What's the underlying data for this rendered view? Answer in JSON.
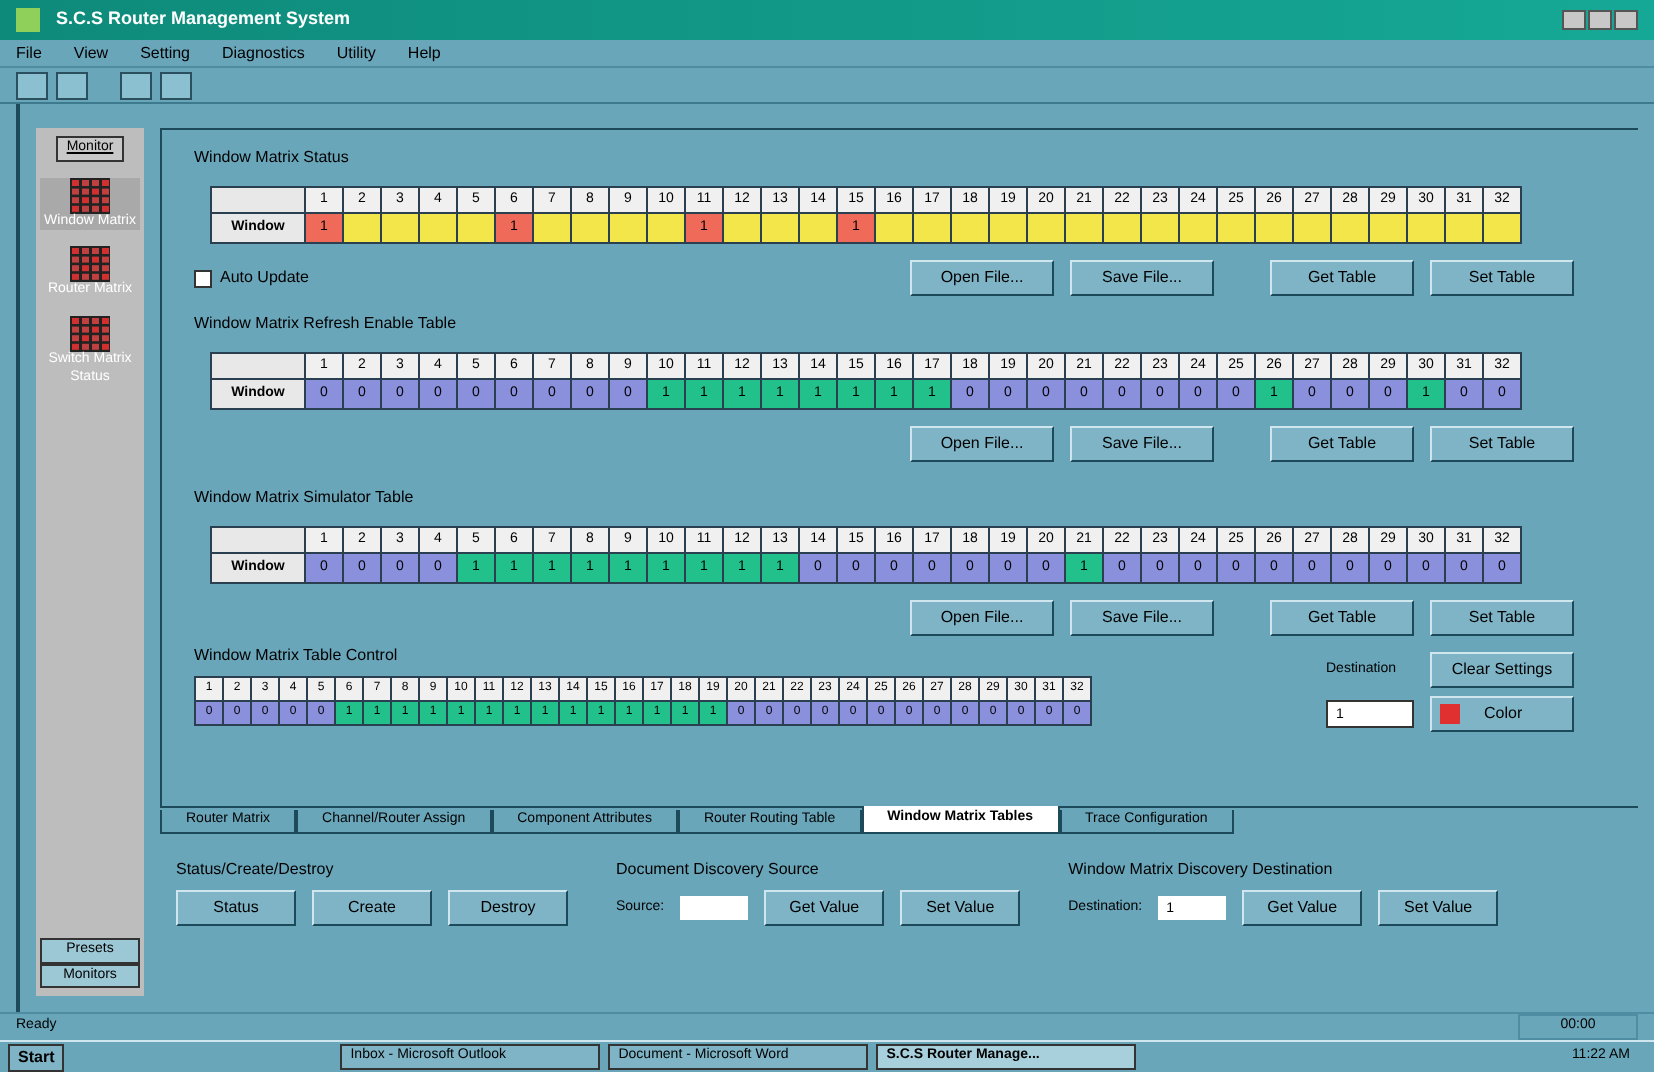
{
  "window": {
    "title": "S.C.S Router Management System"
  },
  "menu": [
    "File",
    "View",
    "Setting",
    "Diagnostics",
    "Utility",
    "Help"
  ],
  "sidebar": {
    "tab": "Monitor",
    "items": [
      {
        "label": "Window Matrix",
        "selected": true
      },
      {
        "label": "Router Matrix",
        "selected": false
      },
      {
        "label": "Switch Matrix Status",
        "selected": false
      }
    ],
    "bottom_buttons": [
      "Presets",
      "Monitors"
    ]
  },
  "status_table": {
    "title": "Window Matrix Status",
    "row_label": "Window",
    "headers": [
      "1",
      "2",
      "3",
      "4",
      "5",
      "6",
      "7",
      "8",
      "9",
      "10",
      "11",
      "12",
      "13",
      "14",
      "15",
      "16",
      "17",
      "18",
      "19",
      "20",
      "21",
      "22",
      "23",
      "24",
      "25",
      "26",
      "27",
      "28",
      "29",
      "30",
      "31",
      "32"
    ],
    "cells": [
      {
        "value": "1",
        "alarm": true
      },
      {
        "alarm": false
      },
      {
        "alarm": false
      },
      {
        "alarm": false
      },
      {
        "alarm": false
      },
      {
        "value": "1",
        "alarm": true
      },
      {
        "alarm": false
      },
      {
        "alarm": false
      },
      {
        "alarm": false
      },
      {
        "alarm": false
      },
      {
        "value": "1",
        "alarm": true
      },
      {
        "alarm": false
      },
      {
        "alarm": false
      },
      {
        "alarm": false
      },
      {
        "value": "1",
        "alarm": true
      },
      {
        "alarm": false
      },
      {
        "alarm": false
      },
      {
        "alarm": false
      },
      {
        "alarm": false
      },
      {
        "alarm": false
      },
      {
        "alarm": false
      },
      {
        "alarm": false
      },
      {
        "alarm": false
      },
      {
        "alarm": false
      },
      {
        "alarm": false
      },
      {
        "alarm": false
      },
      {
        "alarm": false
      },
      {
        "alarm": false
      },
      {
        "alarm": false
      },
      {
        "alarm": false
      },
      {
        "alarm": false
      },
      {
        "alarm": false
      }
    ]
  },
  "auto_update": {
    "label": "Auto Update",
    "checked": false
  },
  "status_buttons": [
    "Open File...",
    "Save File...",
    "Get Table",
    "Set Table"
  ],
  "refresh_table": {
    "title": "Window Matrix Refresh Enable Table",
    "row_label": "Window",
    "headers": [
      "1",
      "2",
      "3",
      "4",
      "5",
      "6",
      "7",
      "8",
      "9",
      "10",
      "11",
      "12",
      "13",
      "14",
      "15",
      "16",
      "17",
      "18",
      "19",
      "20",
      "21",
      "22",
      "23",
      "24",
      "25",
      "26",
      "27",
      "28",
      "29",
      "30",
      "31",
      "32"
    ],
    "cells": [
      {
        "value": "0",
        "on": false
      },
      {
        "value": "0",
        "on": false
      },
      {
        "value": "0",
        "on": false
      },
      {
        "value": "0",
        "on": false
      },
      {
        "value": "0",
        "on": false
      },
      {
        "value": "0",
        "on": false
      },
      {
        "value": "0",
        "on": false
      },
      {
        "value": "0",
        "on": false
      },
      {
        "value": "0",
        "on": false
      },
      {
        "value": "1",
        "on": true
      },
      {
        "value": "1",
        "on": true
      },
      {
        "value": "1",
        "on": true
      },
      {
        "value": "1",
        "on": true
      },
      {
        "value": "1",
        "on": true
      },
      {
        "value": "1",
        "on": true
      },
      {
        "value": "1",
        "on": true
      },
      {
        "value": "1",
        "on": true
      },
      {
        "value": "0",
        "on": false
      },
      {
        "value": "0",
        "on": false
      },
      {
        "value": "0",
        "on": false
      },
      {
        "value": "0",
        "on": false
      },
      {
        "value": "0",
        "on": false
      },
      {
        "value": "0",
        "on": false
      },
      {
        "value": "0",
        "on": false
      },
      {
        "value": "0",
        "on": false
      },
      {
        "value": "1",
        "on": true
      },
      {
        "value": "0",
        "on": false
      },
      {
        "value": "0",
        "on": false
      },
      {
        "value": "0",
        "on": false
      },
      {
        "value": "1",
        "on": true
      },
      {
        "value": "0",
        "on": false
      },
      {
        "value": "0",
        "on": false
      }
    ]
  },
  "refresh_buttons": [
    "Open File...",
    "Save File...",
    "Get Table",
    "Set Table"
  ],
  "simulator_table": {
    "title": "Window Matrix Simulator Table",
    "row_label": "Window",
    "headers": [
      "1",
      "2",
      "3",
      "4",
      "5",
      "6",
      "7",
      "8",
      "9",
      "10",
      "11",
      "12",
      "13",
      "14",
      "15",
      "16",
      "17",
      "18",
      "19",
      "20",
      "21",
      "22",
      "23",
      "24",
      "25",
      "26",
      "27",
      "28",
      "29",
      "30",
      "31",
      "32"
    ],
    "cells": [
      {
        "value": "0",
        "on": false
      },
      {
        "value": "0",
        "on": false
      },
      {
        "value": "0",
        "on": false
      },
      {
        "value": "0",
        "on": false
      },
      {
        "value": "1",
        "on": true
      },
      {
        "value": "1",
        "on": true
      },
      {
        "value": "1",
        "on": true
      },
      {
        "value": "1",
        "on": true
      },
      {
        "value": "1",
        "on": true
      },
      {
        "value": "1",
        "on": true
      },
      {
        "value": "1",
        "on": true
      },
      {
        "value": "1",
        "on": true
      },
      {
        "value": "1",
        "on": true
      },
      {
        "value": "0",
        "on": false
      },
      {
        "value": "0",
        "on": false
      },
      {
        "value": "0",
        "on": false
      },
      {
        "value": "0",
        "on": false
      },
      {
        "value": "0",
        "on": false
      },
      {
        "value": "0",
        "on": false
      },
      {
        "value": "0",
        "on": false
      },
      {
        "value": "1",
        "on": true
      },
      {
        "value": "0",
        "on": false
      },
      {
        "value": "0",
        "on": false
      },
      {
        "value": "0",
        "on": false
      },
      {
        "value": "0",
        "on": false
      },
      {
        "value": "0",
        "on": false
      },
      {
        "value": "0",
        "on": false
      },
      {
        "value": "0",
        "on": false
      },
      {
        "value": "0",
        "on": false
      },
      {
        "value": "0",
        "on": false
      },
      {
        "value": "0",
        "on": false
      },
      {
        "value": "0",
        "on": false
      }
    ]
  },
  "simulator_buttons": [
    "Open File...",
    "Save File...",
    "Get Table",
    "Set Table"
  ],
  "control_table": {
    "title": "Window Matrix Table Control",
    "headers": [
      "1",
      "2",
      "3",
      "4",
      "5",
      "6",
      "7",
      "8",
      "9",
      "10",
      "11",
      "12",
      "13",
      "14",
      "15",
      "16",
      "17",
      "18",
      "19",
      "20",
      "21",
      "22",
      "23",
      "24",
      "25",
      "26",
      "27",
      "28",
      "29",
      "30",
      "31",
      "32"
    ],
    "cells": [
      {
        "value": "0",
        "on": false
      },
      {
        "value": "0",
        "on": false
      },
      {
        "value": "0",
        "on": false
      },
      {
        "value": "0",
        "on": false
      },
      {
        "value": "0",
        "on": false
      },
      {
        "value": "1",
        "on": true
      },
      {
        "value": "1",
        "on": true
      },
      {
        "value": "1",
        "on": true
      },
      {
        "value": "1",
        "on": true
      },
      {
        "value": "1",
        "on": true
      },
      {
        "value": "1",
        "on": true
      },
      {
        "value": "1",
        "on": true
      },
      {
        "value": "1",
        "on": true
      },
      {
        "value": "1",
        "on": true
      },
      {
        "value": "1",
        "on": true
      },
      {
        "value": "1",
        "on": true
      },
      {
        "value": "1",
        "on": true
      },
      {
        "value": "1",
        "on": true
      },
      {
        "value": "1",
        "on": true
      },
      {
        "value": "0",
        "on": false
      },
      {
        "value": "0",
        "on": false
      },
      {
        "value": "0",
        "on": false
      },
      {
        "value": "0",
        "on": false
      },
      {
        "value": "0",
        "on": false
      },
      {
        "value": "0",
        "on": false
      },
      {
        "value": "0",
        "on": false
      },
      {
        "value": "0",
        "on": false
      },
      {
        "value": "0",
        "on": false
      },
      {
        "value": "0",
        "on": false
      },
      {
        "value": "0",
        "on": false
      },
      {
        "value": "0",
        "on": false
      },
      {
        "value": "0",
        "on": false
      }
    ]
  },
  "destination": {
    "label": "Destination",
    "value": "1",
    "clear_button": "Clear Settings",
    "color_button": "Color",
    "color": "#e03030"
  },
  "tabs": [
    {
      "label": "Router Matrix",
      "selected": false
    },
    {
      "label": "Channel/Router Assign",
      "selected": false
    },
    {
      "label": "Component Attributes",
      "selected": false
    },
    {
      "label": "Router Routing Table",
      "selected": false
    },
    {
      "label": "Window Matrix Tables",
      "selected": true
    },
    {
      "label": "Trace Configuration",
      "selected": false
    }
  ],
  "groups": [
    {
      "title": "Status/Create/Destroy",
      "buttons": [
        "Status",
        "Create",
        "Destroy"
      ]
    },
    {
      "title": "Document Discovery Source",
      "field_label": "Source:",
      "buttons": [
        "Get Value",
        "Set Value"
      ]
    },
    {
      "title": "Window Matrix Discovery Destination",
      "field_label": "Destination:",
      "value": "1",
      "buttons": [
        "Get Value",
        "Set Value"
      ]
    }
  ],
  "status_bar": {
    "text": "Ready",
    "time": "00:00"
  },
  "taskbar": {
    "start": "Start",
    "tasks": [
      {
        "label": "Inbox - Microsoft Outlook",
        "selected": false
      },
      {
        "label": "Document - Microsoft Word",
        "selected": false
      },
      {
        "label": "S.C.S Router Manage...",
        "selected": true
      }
    ],
    "clock": "11:22 AM"
  }
}
